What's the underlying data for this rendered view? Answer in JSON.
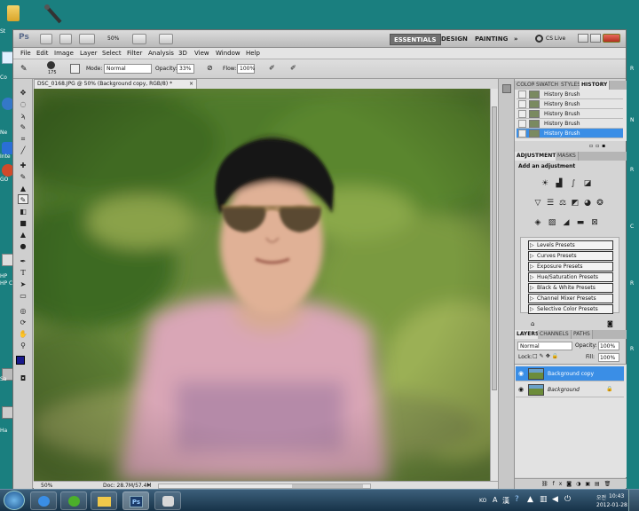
{
  "desktop": {
    "icons": [
      {
        "name": "folder-icon",
        "label": "St"
      },
      {
        "name": "recycle-icon",
        "label": "Co"
      },
      {
        "name": "network-icon",
        "label": "Ne"
      },
      {
        "name": "ie-icon",
        "label": "Inte"
      },
      {
        "name": "app-icon",
        "label": "GO"
      },
      {
        "name": "hp-icon",
        "label": "HP Co"
      },
      {
        "name": "printer-icon",
        "label": "Ha"
      },
      {
        "name": "network2-icon",
        "label": "Sa"
      }
    ],
    "hp_label": "HP",
    "r_labels": [
      "R",
      "N",
      "R",
      "C",
      "R",
      "R"
    ]
  },
  "app": {
    "logo": "Ps",
    "zoom": "50%",
    "workspaces": [
      "ESSENTIALS",
      "DESIGN",
      "PAINTING",
      "»"
    ],
    "cs_live": "CS Live",
    "menu": [
      "File",
      "Edit",
      "Image",
      "Layer",
      "Select",
      "Filter",
      "Analysis",
      "3D",
      "View",
      "Window",
      "Help"
    ]
  },
  "options": {
    "brush_size": "175",
    "mode_label": "Mode:",
    "mode_value": "Normal",
    "opacity_label": "Opacity:",
    "opacity_value": "33%",
    "flow_label": "Flow:",
    "flow_value": "100%"
  },
  "document": {
    "tab_title": "DSC_0168.JPG @ 50% (Background copy, RGB/8) *",
    "status_zoom": "50%",
    "status_doc": "Doc: 28.7M/57.4M"
  },
  "panels": {
    "history_tabs": [
      "COLOR",
      "SWATCH",
      "STYLES",
      "HISTORY"
    ],
    "history_items": [
      {
        "label": "History Brush",
        "selected": false
      },
      {
        "label": "History Brush",
        "selected": false
      },
      {
        "label": "History Brush",
        "selected": false
      },
      {
        "label": "History Brush",
        "selected": false
      },
      {
        "label": "History Brush",
        "selected": true
      }
    ],
    "adjust_tabs": [
      "ADJUSTMENTS",
      "MASKS"
    ],
    "add_adjustment": "Add an adjustment",
    "presets": [
      "Levels Presets",
      "Curves Presets",
      "Exposure Presets",
      "Hue/Saturation Presets",
      "Black & White Presets",
      "Channel Mixer Presets",
      "Selective Color Presets"
    ],
    "layer_tabs": [
      "LAYERS",
      "CHANNELS",
      "PATHS"
    ],
    "blend_mode": "Normal",
    "opacity_label": "Opacity:",
    "opacity_value": "100%",
    "lock_label": "Lock:",
    "fill_label": "Fill:",
    "fill_value": "100%",
    "layers": [
      {
        "name": "Background copy",
        "selected": true
      },
      {
        "name": "Background",
        "selected": false
      }
    ]
  },
  "taskbar": {
    "ime": "KO",
    "ime_a": "A",
    "ime_hanja": "漢",
    "ampm": "오전",
    "time": "10:43",
    "date": "2012-01-28"
  },
  "colors": {
    "desktop": "#1a7f7f",
    "selection": "#3a8ee6",
    "foreground": "#1a1a8c",
    "background": "#2a8a2a"
  }
}
